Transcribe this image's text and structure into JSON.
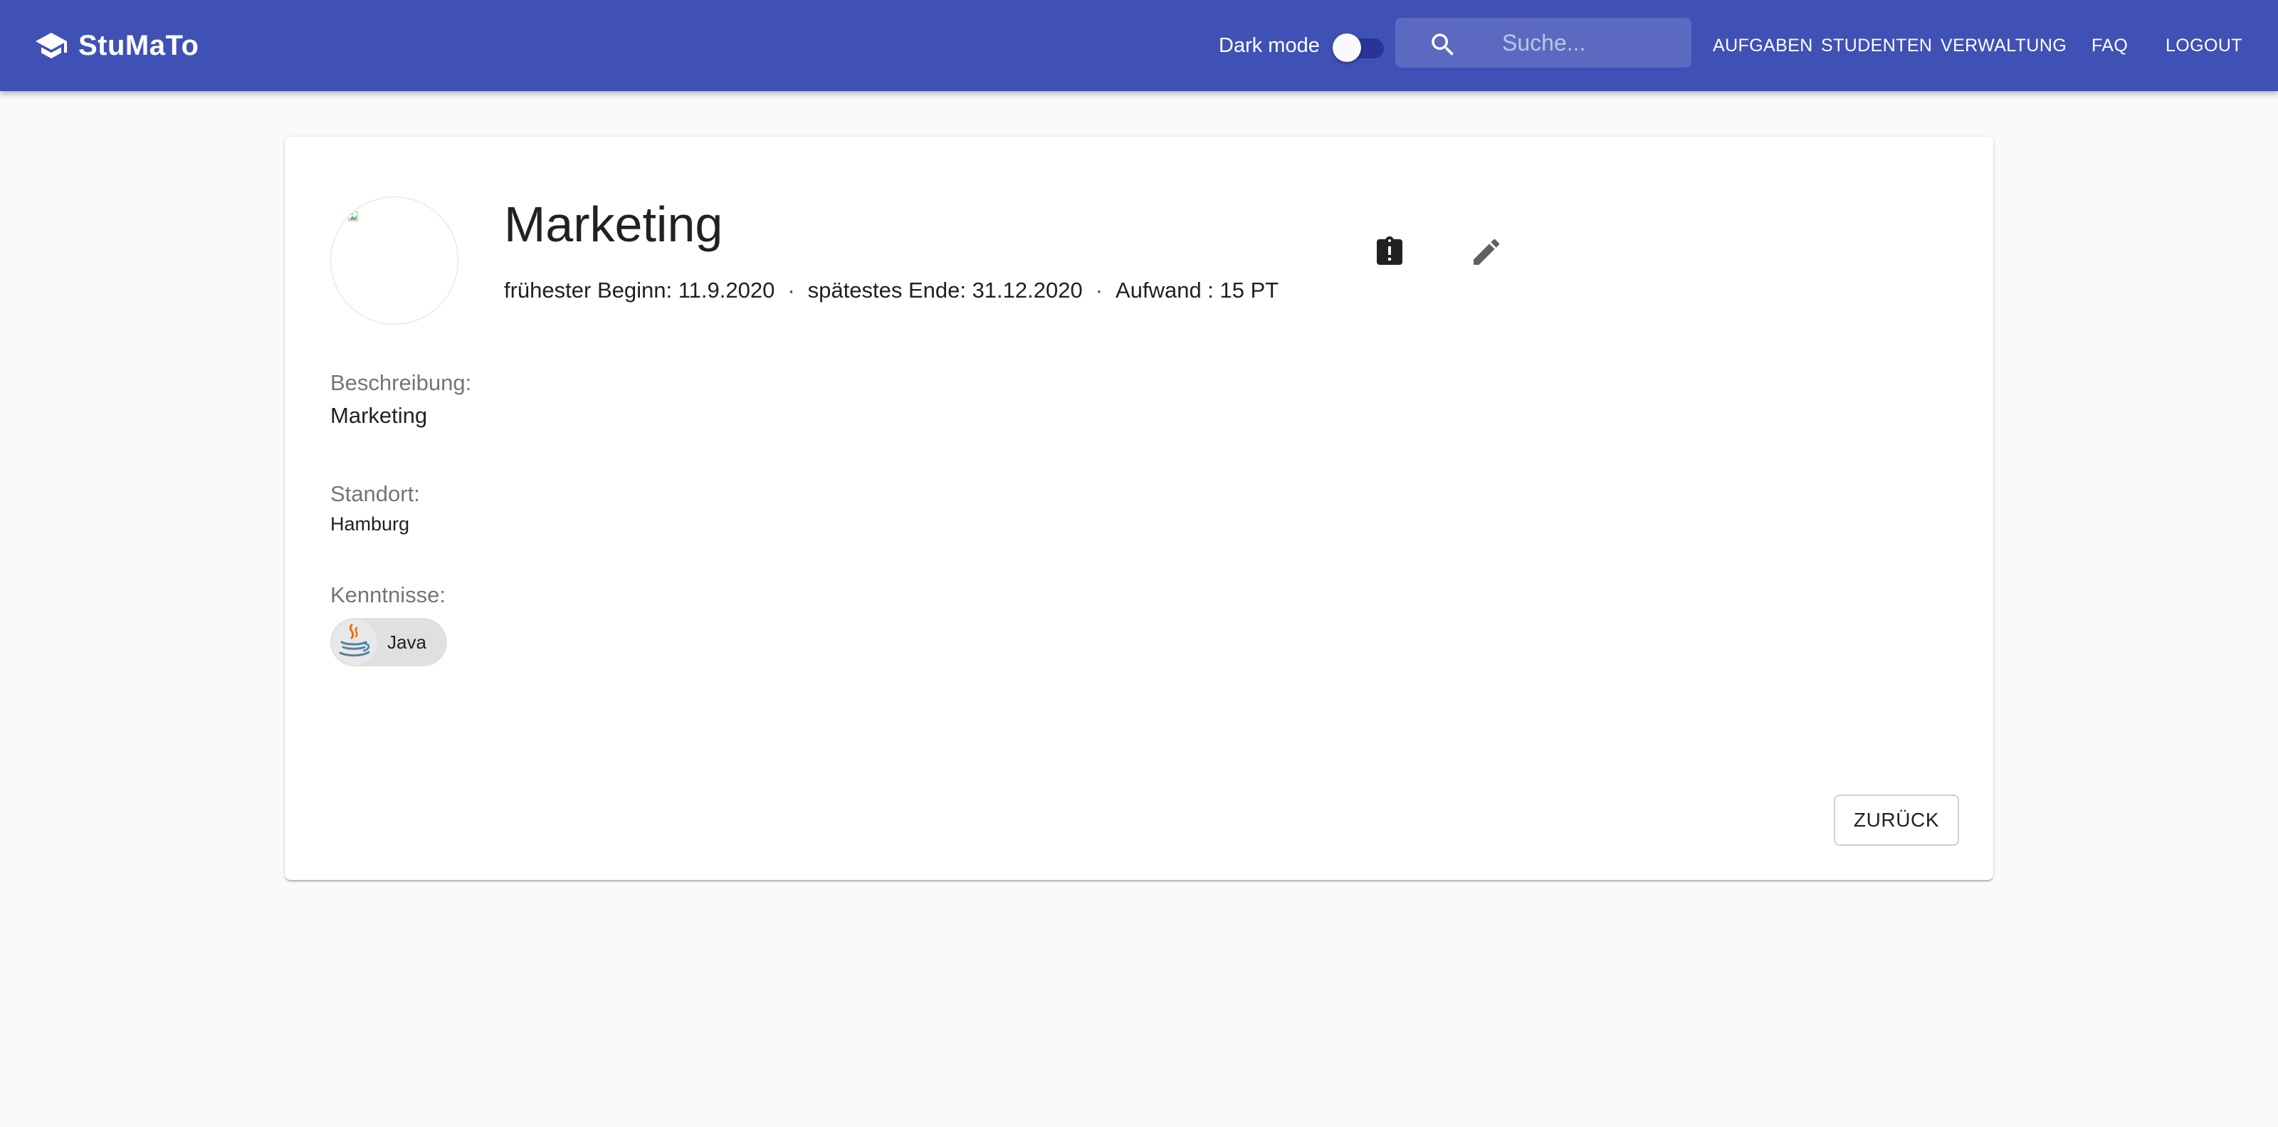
{
  "app": {
    "title": "StuMaTo"
  },
  "toolbar": {
    "dark_mode_label": "Dark mode",
    "dark_mode_enabled": false,
    "search_placeholder": "Suche...",
    "search_value": ""
  },
  "nav": {
    "items": [
      {
        "label": "AUFGABEN"
      },
      {
        "label": "STUDENTEN"
      },
      {
        "label": "VERWALTUNG"
      },
      {
        "label": "FAQ"
      },
      {
        "label": "LOGOUT"
      }
    ]
  },
  "task": {
    "title": "Marketing",
    "meta": {
      "start": "frühester Beginn: 11.9.2020",
      "end": "spätestes Ende: 31.12.2020",
      "effort": "Aufwand : 15 PT",
      "separator": "·"
    },
    "description_label": "Beschreibung:",
    "description": "Marketing",
    "location_label": "Standort:",
    "location": "Hamburg",
    "skills_label": "Kenntnisse:",
    "skills": [
      {
        "label": "Java",
        "icon": "java-logo-icon"
      }
    ]
  },
  "actions": {
    "report_icon": "clipboard-alert-icon",
    "edit_icon": "pencil-icon",
    "back_label": "ZURÜCK"
  },
  "colors": {
    "primary": "#3f51b5",
    "switch_track": "#283593",
    "background": "#fafafa"
  }
}
